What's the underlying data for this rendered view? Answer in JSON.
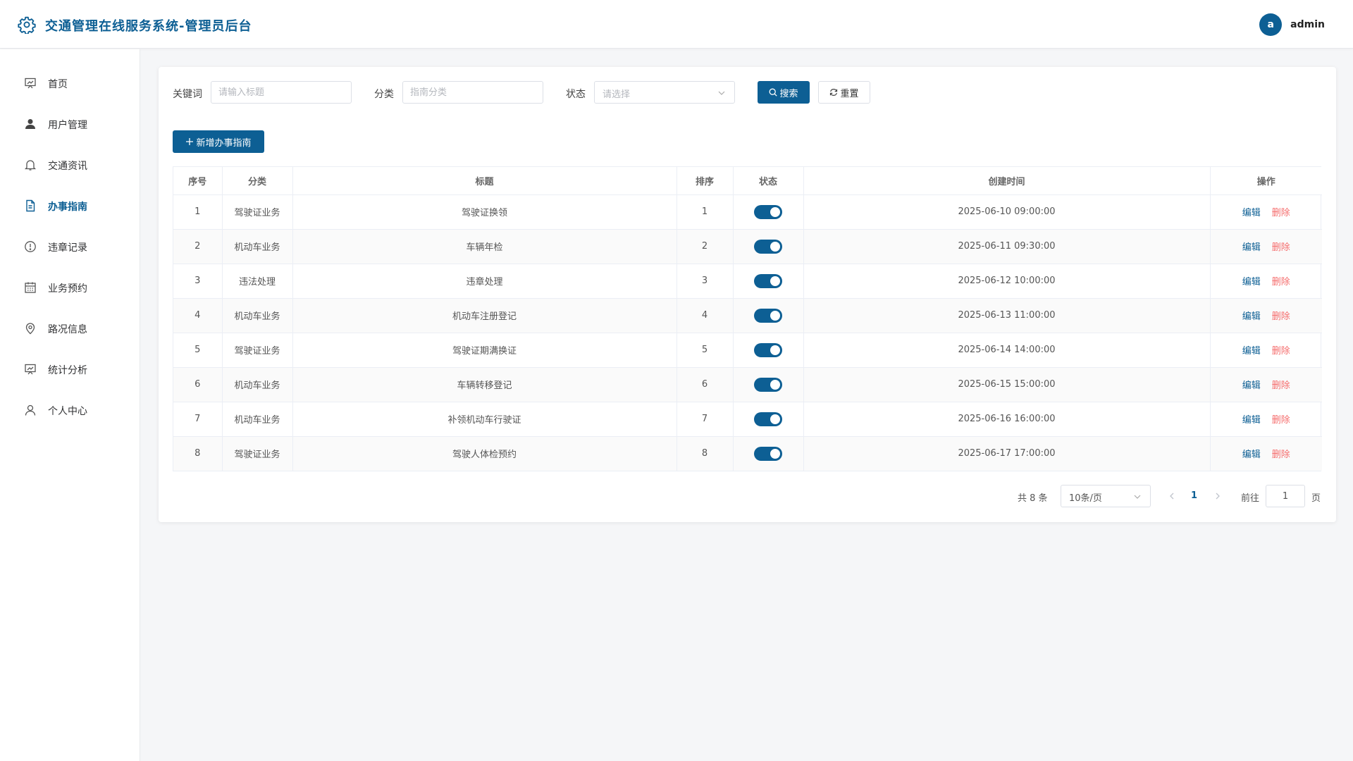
{
  "header": {
    "app_title": "交通管理在线服务系统-管理员后台",
    "avatar_letter": "a",
    "user_name": "admin",
    "brand_color": "#0d5f94"
  },
  "sidebar": {
    "active_index": 3,
    "items": [
      {
        "label": "首页",
        "icon": "dashboard-icon"
      },
      {
        "label": "用户管理",
        "icon": "user-icon"
      },
      {
        "label": "交通资讯",
        "icon": "bell-icon"
      },
      {
        "label": "办事指南",
        "icon": "document-icon"
      },
      {
        "label": "违章记录",
        "icon": "warning-icon"
      },
      {
        "label": "业务预约",
        "icon": "calendar-icon"
      },
      {
        "label": "路况信息",
        "icon": "location-icon"
      },
      {
        "label": "统计分析",
        "icon": "chart-icon"
      },
      {
        "label": "个人中心",
        "icon": "person-icon"
      }
    ]
  },
  "filters": {
    "keyword_label": "关键词",
    "keyword_placeholder": "请输入标题",
    "keyword_value": "",
    "category_label": "分类",
    "category_placeholder": "指南分类",
    "category_value": "",
    "status_label": "状态",
    "status_placeholder": "请选择",
    "search_label": "搜索",
    "reset_label": "重置"
  },
  "toolbar": {
    "add_label": "新增办事指南"
  },
  "table": {
    "columns": [
      "序号",
      "分类",
      "标题",
      "排序",
      "状态",
      "创建时间",
      "操作"
    ],
    "edit_label": "编辑",
    "delete_label": "删除",
    "rows": [
      {
        "index": "1",
        "category": "驾驶证业务",
        "title": "驾驶证换领",
        "sort": "1",
        "enabled": true,
        "created": "2025-06-10 09:00:00"
      },
      {
        "index": "2",
        "category": "机动车业务",
        "title": "车辆年检",
        "sort": "2",
        "enabled": true,
        "created": "2025-06-11 09:30:00"
      },
      {
        "index": "3",
        "category": "违法处理",
        "title": "违章处理",
        "sort": "3",
        "enabled": true,
        "created": "2025-06-12 10:00:00"
      },
      {
        "index": "4",
        "category": "机动车业务",
        "title": "机动车注册登记",
        "sort": "4",
        "enabled": true,
        "created": "2025-06-13 11:00:00"
      },
      {
        "index": "5",
        "category": "驾驶证业务",
        "title": "驾驶证期满换证",
        "sort": "5",
        "enabled": true,
        "created": "2025-06-14 14:00:00"
      },
      {
        "index": "6",
        "category": "机动车业务",
        "title": "车辆转移登记",
        "sort": "6",
        "enabled": true,
        "created": "2025-06-15 15:00:00"
      },
      {
        "index": "7",
        "category": "机动车业务",
        "title": "补领机动车行驶证",
        "sort": "7",
        "enabled": true,
        "created": "2025-06-16 16:00:00"
      },
      {
        "index": "8",
        "category": "驾驶证业务",
        "title": "驾驶人体检预约",
        "sort": "8",
        "enabled": true,
        "created": "2025-06-17 17:00:00"
      }
    ]
  },
  "pagination": {
    "total_text": "共 8 条",
    "page_size": "10条/页",
    "current_page": "1",
    "goto_label": "前往",
    "goto_value": "1",
    "page_unit": "页"
  }
}
